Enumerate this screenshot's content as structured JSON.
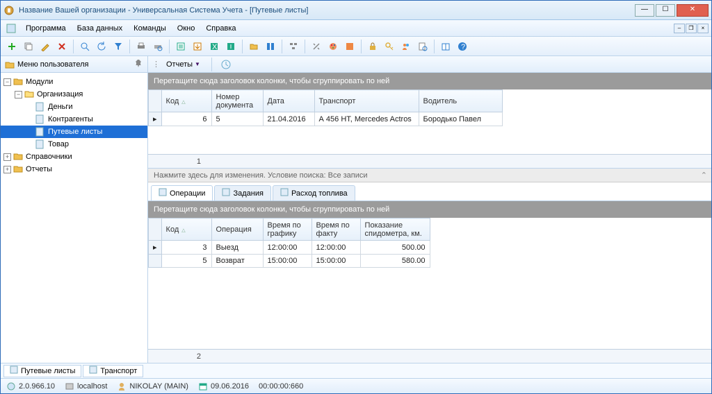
{
  "window": {
    "title": "Название Вашей организации - Универсальная Система Учета - [Путевые листы]"
  },
  "menu": {
    "program": "Программа",
    "db": "База данных",
    "commands": "Команды",
    "window": "Окно",
    "help": "Справка"
  },
  "sidebar": {
    "header": "Меню пользователя",
    "nodes": {
      "modules": "Модули",
      "org": "Организация",
      "money": "Деньги",
      "contr": "Контрагенты",
      "waybills": "Путевые листы",
      "goods": "Товар",
      "dictionaries": "Справочники",
      "reports": "Отчеты"
    }
  },
  "reports_btn": "Отчеты",
  "group_hint": "Перетащите сюда заголовок колонки, чтобы сгруппировать по ней",
  "top_grid": {
    "cols": {
      "code": "Код",
      "docnum": "Номер документа",
      "date": "Дата",
      "transport": "Транспорт",
      "driver": "Водитель"
    },
    "rows": [
      {
        "code": "6",
        "docnum": "5",
        "date": "21.04.2016",
        "transport": "А 456 НТ, Mercedes Actros",
        "driver": "Бородько Павел"
      }
    ],
    "footer_count": "1"
  },
  "search_hint": "Нажмите здесь для изменения. Условие поиска: Все записи",
  "detail_tabs": {
    "ops": "Операции",
    "tasks": "Задания",
    "fuel": "Расход топлива"
  },
  "detail_grid": {
    "cols": {
      "code": "Код",
      "op": "Операция",
      "sched": "Время по графику",
      "fact": "Время по факту",
      "odo": "Показание спидометра, км."
    },
    "rows": [
      {
        "code": "3",
        "op": "Выезд",
        "sched": "12:00:00",
        "fact": "12:00:00",
        "odo": "500.00"
      },
      {
        "code": "5",
        "op": "Возврат",
        "sched": "15:00:00",
        "fact": "15:00:00",
        "odo": "580.00"
      }
    ],
    "footer_count": "2"
  },
  "bottom_tabs": {
    "waybills": "Путевые листы",
    "transport": "Транспорт"
  },
  "status": {
    "version": "2.0.966.10",
    "host": "localhost",
    "user": "NIKOLAY (MAIN)",
    "date": "09.06.2016",
    "time": "00:00:00:660"
  }
}
